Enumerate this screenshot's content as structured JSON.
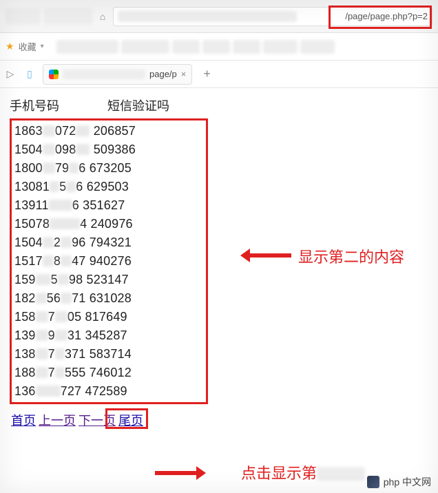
{
  "browser": {
    "address_visible": "/page/page.php?p=2",
    "bookmarks_label": "收藏",
    "tab_title_visible": "page/p",
    "new_tab_tooltip": "+"
  },
  "headers": {
    "phone": "手机号码",
    "code": "短信验证吗"
  },
  "rows": [
    {
      "p1": "1863",
      "p2": "072",
      "code": "206857"
    },
    {
      "p1": "1504",
      "p2": "098",
      "code": "509386"
    },
    {
      "p1": "1800",
      "p2": "79",
      "p3": "6",
      "code": "673205"
    },
    {
      "p1": "13081",
      "p2": "5",
      "p3": "6",
      "code": "629503"
    },
    {
      "p1": "13911",
      "p2": "",
      "p3": "6",
      "code": "351627"
    },
    {
      "p1": "15078",
      "p2": "",
      "p3": "4",
      "code": "240976"
    },
    {
      "p1": "1504",
      "p2": "2",
      "p3": "96",
      "code": "794321"
    },
    {
      "p1": "1517",
      "p2": "8",
      "p3": "47",
      "code": "940276"
    },
    {
      "p1": "159",
      "p2": "5",
      "p3": "98",
      "code": "523147"
    },
    {
      "p1": "182",
      "p2": "56",
      "p3": "71",
      "code": "631028"
    },
    {
      "p1": "158",
      "p2": "7",
      "p3": "05",
      "code": "817649"
    },
    {
      "p1": "139",
      "p2": "9",
      "p3": "31",
      "code": "345287"
    },
    {
      "p1": "138",
      "p2": "7",
      "p3": "371",
      "code": "583714"
    },
    {
      "p1": "188",
      "p2": "7",
      "p3": "555",
      "code": "746012"
    },
    {
      "p1": "136",
      "p2": "",
      "p3": "727",
      "code": "472589"
    }
  ],
  "pager": {
    "first": "首页",
    "prev": "上一页",
    "next": "下一页",
    "last": "尾页"
  },
  "annotations": {
    "right_text": "显示第二的内容",
    "bottom_text": "点击显示第"
  },
  "watermark": "php 中文网"
}
